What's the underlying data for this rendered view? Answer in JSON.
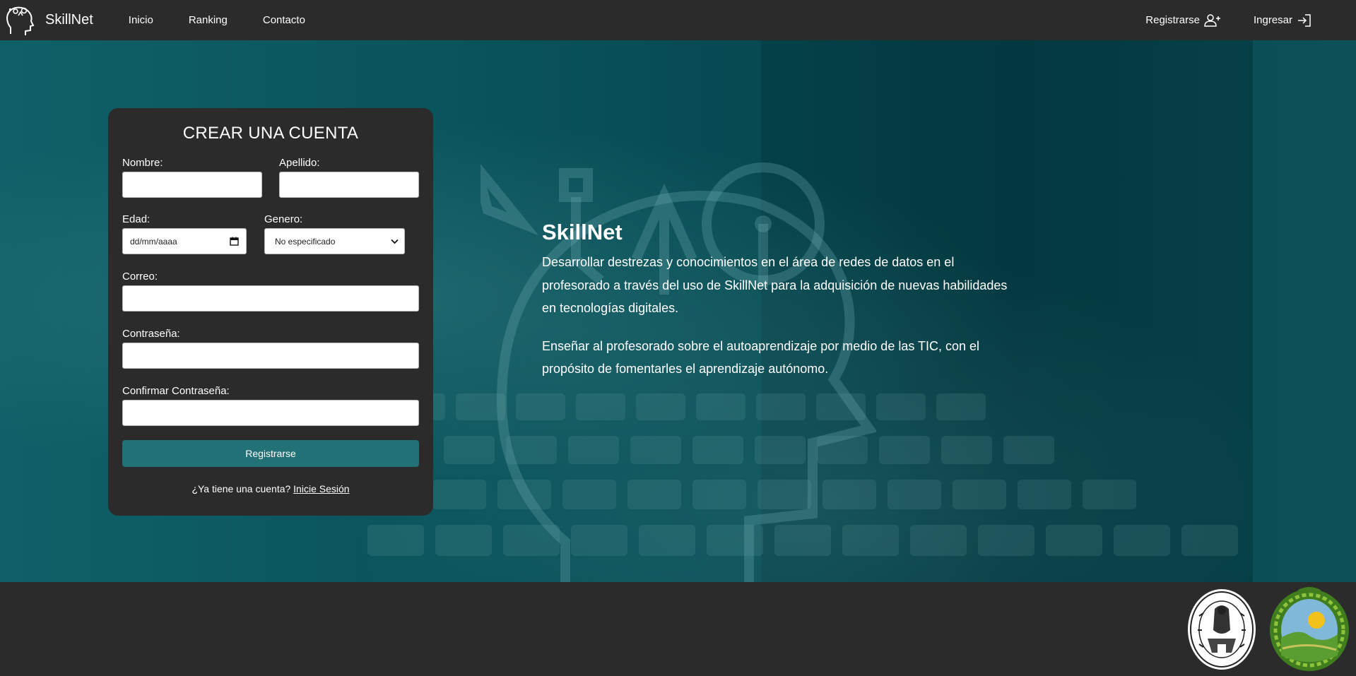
{
  "app": {
    "brand": "SkillNet",
    "accent_color": "#227176",
    "nav_color": "#2b2b2b"
  },
  "nav": {
    "links": [
      "Inicio",
      "Ranking",
      "Contacto"
    ],
    "register_label": "Registrarse",
    "login_label": "Ingresar"
  },
  "form": {
    "title": "CREAR UNA CUENTA",
    "first_name_label": "Nombre:",
    "last_name_label": "Apellido:",
    "age_label": "Edad:",
    "age_placeholder": "dd/mm/aaaa",
    "gender_label": "Genero:",
    "gender_value": "No especificado",
    "email_label": "Correo:",
    "password_label": "Contraseña:",
    "confirm_password_label": "Confirmar Contraseña:",
    "submit_label": "Registrarse",
    "have_account_text": "¿Ya tiene una cuenta?",
    "signin_link": "Inicie Sesión"
  },
  "hero": {
    "title": "SkillNet",
    "paragraph1": "Desarrollar destrezas y conocimientos en el área de redes de datos en el profesorado a través del uso de SkillNet para la adquisición de nuevas habilidades en tecnologías digitales.",
    "paragraph2": "Enseñar al profesorado sobre el autoaprendizaje por medio de las TIC, con el propósito de fomentarles el aprendizaje autónomo."
  },
  "icons": {
    "brand": "head-gears-icon",
    "register": "user-plus-icon",
    "login": "sign-in-icon",
    "calendar": "calendar-icon",
    "dropdown": "chevron-down-icon"
  }
}
